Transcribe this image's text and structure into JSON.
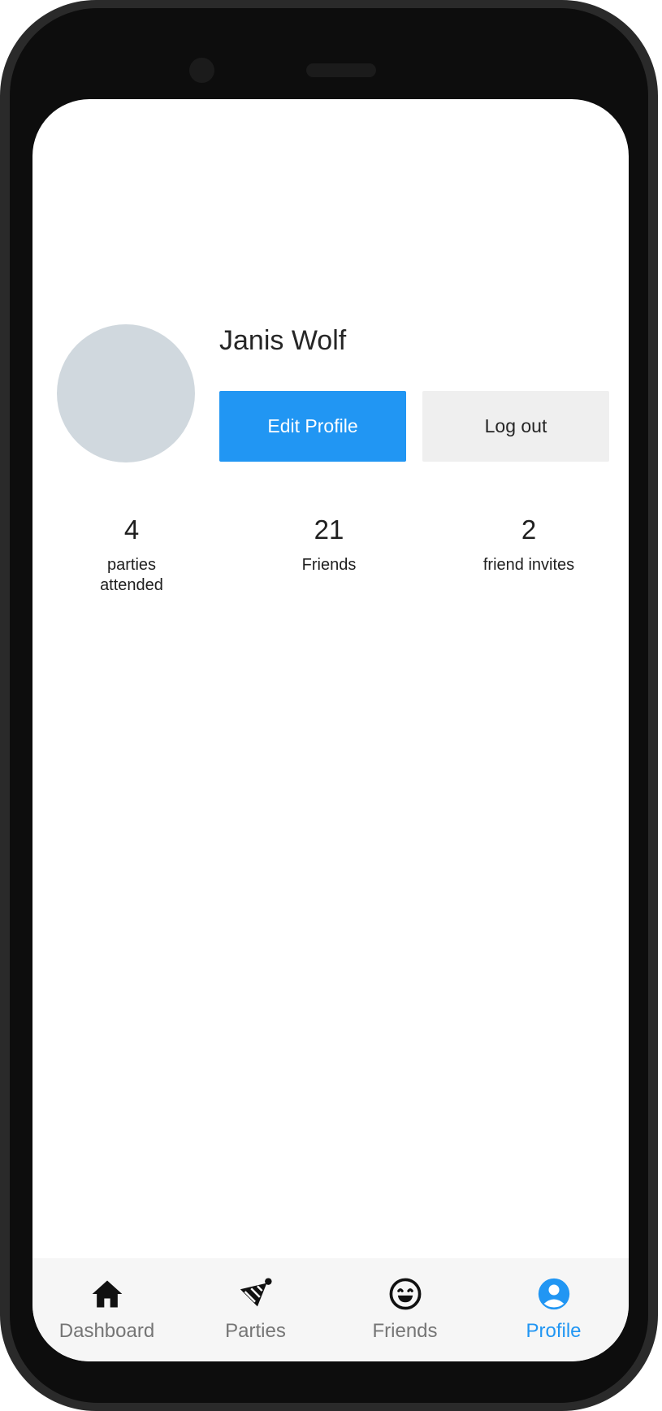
{
  "profile": {
    "name": "Janis Wolf",
    "edit_label": "Edit Profile",
    "logout_label": "Log out"
  },
  "stats": [
    {
      "value": "4",
      "label": "parties attended"
    },
    {
      "value": "21",
      "label": "Friends"
    },
    {
      "value": "2",
      "label": "friend invites"
    }
  ],
  "nav": {
    "active": "Profile",
    "items": [
      {
        "label": "Dashboard",
        "icon": "home-icon"
      },
      {
        "label": "Parties",
        "icon": "party-hat-icon"
      },
      {
        "label": "Friends",
        "icon": "smiley-icon"
      },
      {
        "label": "Profile",
        "icon": "account-circle-icon"
      }
    ]
  },
  "colors": {
    "accent": "#2196f3",
    "avatar_placeholder": "#d0d8de",
    "secondary_button": "#efefef",
    "nav_background": "#f6f6f6",
    "inactive_nav": "#757575"
  }
}
